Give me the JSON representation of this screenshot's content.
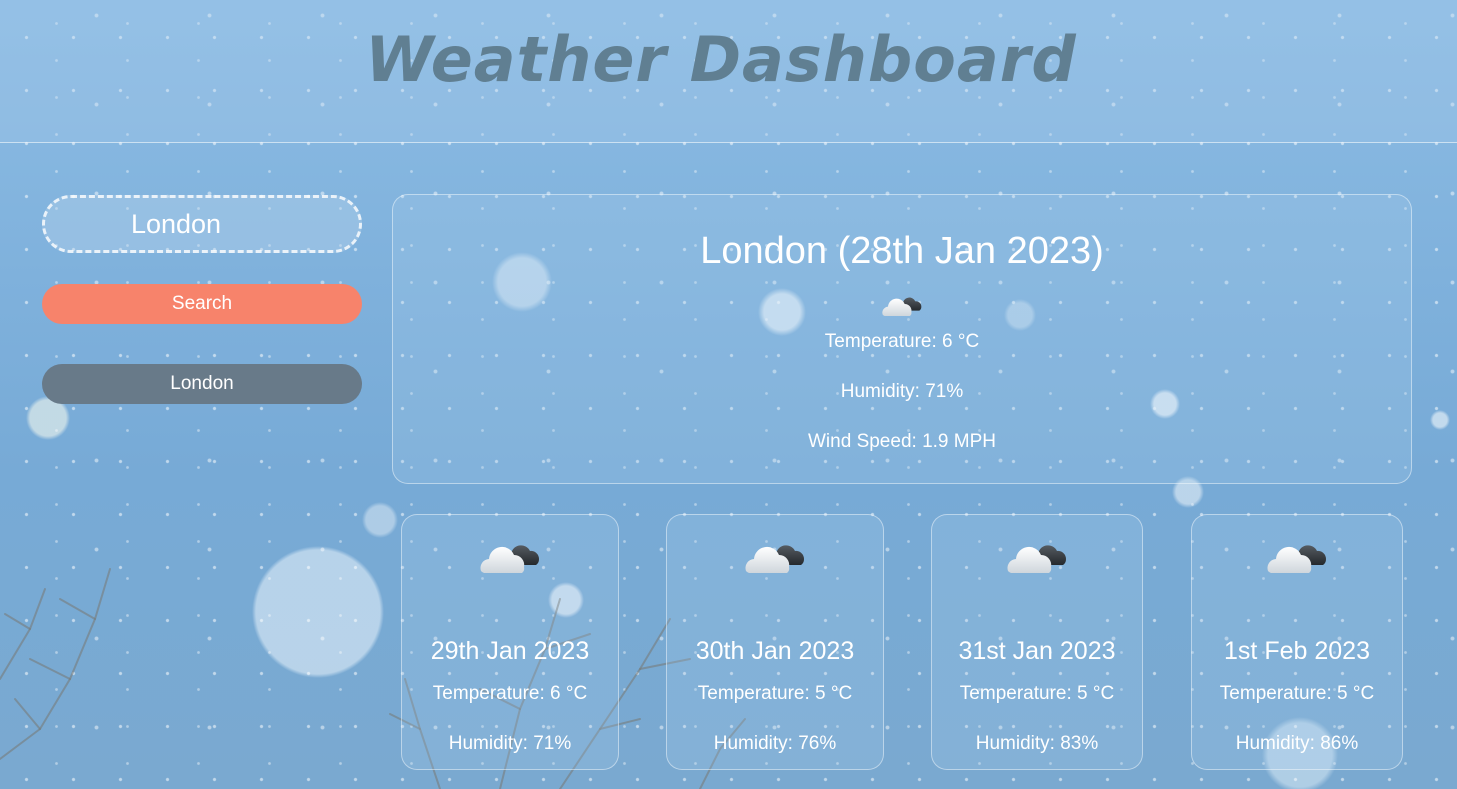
{
  "header": {
    "title": "Weather Dashboard"
  },
  "sidebar": {
    "search_value": "London",
    "search_button": "Search",
    "history": [
      "London"
    ]
  },
  "current": {
    "heading": "London (28th Jan 2023)",
    "icon": "cloud-sun-icon",
    "temperature": "Temperature: 6 °C",
    "humidity": "Humidity: 71%",
    "wind": "Wind Speed: 1.9 MPH"
  },
  "forecast": [
    {
      "date": "29th Jan 2023",
      "icon": "cloud-sun-icon",
      "temperature": "Temperature: 6 °C",
      "humidity": "Humidity: 71%"
    },
    {
      "date": "30th Jan 2023",
      "icon": "cloud-sun-icon",
      "temperature": "Temperature: 5 °C",
      "humidity": "Humidity: 76%"
    },
    {
      "date": "31st Jan 2023",
      "icon": "cloud-sun-icon",
      "temperature": "Temperature: 5 °C",
      "humidity": "Humidity: 83%"
    },
    {
      "date": "1st Feb 2023",
      "icon": "cloud-sun-icon",
      "temperature": "Temperature: 5 °C",
      "humidity": "Humidity: 86%"
    }
  ],
  "colors": {
    "search_button": "#f7836b",
    "history_button": "#687a89",
    "title": "#607f92"
  }
}
